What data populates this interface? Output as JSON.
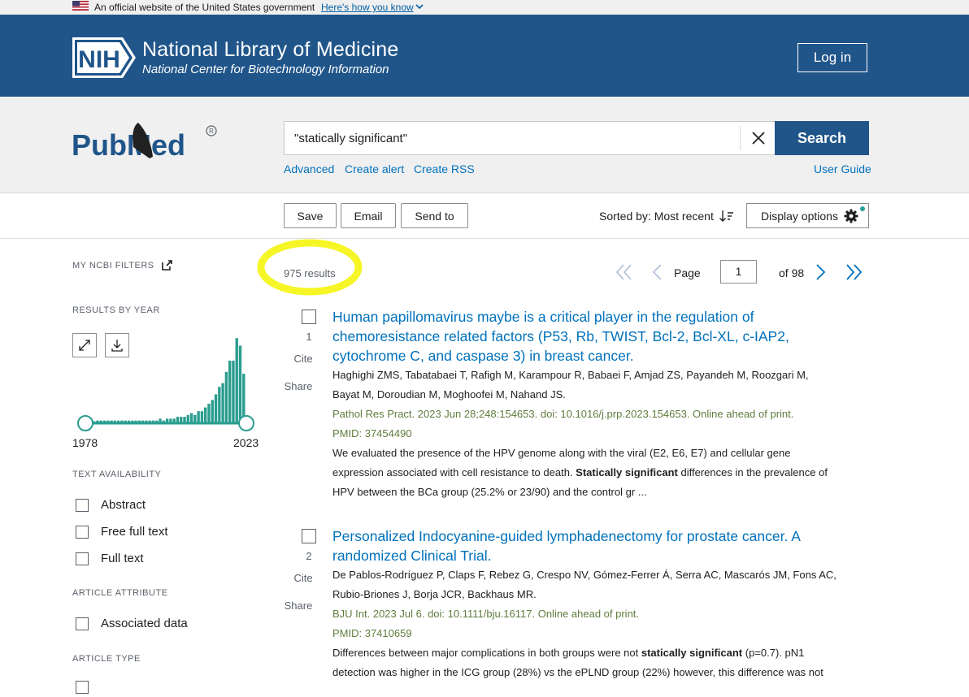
{
  "gov_banner": {
    "text": "An official website of the United States government",
    "link": "Here's how you know"
  },
  "nih_header": {
    "logo_text": "NIH",
    "title": "National Library of Medicine",
    "subtitle": "National Center for Biotechnology Information",
    "login": "Log in"
  },
  "search": {
    "logo_text": "PubMed",
    "query": "\"statically significant\"",
    "button": "Search",
    "links": [
      "Advanced",
      "Create alert",
      "Create RSS"
    ],
    "user_guide": "User Guide"
  },
  "toolbar": {
    "save": "Save",
    "email": "Email",
    "send_to": "Send to",
    "sort": "Sorted by: Most recent",
    "display_options": "Display options"
  },
  "sidebar": {
    "my_filters": "MY NCBI FILTERS",
    "results_by_year": "RESULTS BY YEAR",
    "year_start": "1978",
    "year_end": "2023",
    "text_availability": "TEXT AVAILABILITY",
    "text_filters": [
      "Abstract",
      "Free full text",
      "Full text"
    ],
    "article_attribute": "ARTICLE ATTRIBUTE",
    "attribute_filters": [
      "Associated data"
    ],
    "article_type": "ARTICLE TYPE"
  },
  "chart_data": {
    "type": "bar",
    "x": [
      1978,
      1979,
      1980,
      1981,
      1982,
      1983,
      1984,
      1985,
      1986,
      1987,
      1988,
      1989,
      1990,
      1991,
      1992,
      1993,
      1994,
      1995,
      1996,
      1997,
      1998,
      1999,
      2000,
      2001,
      2002,
      2003,
      2004,
      2005,
      2006,
      2007,
      2008,
      2009,
      2010,
      2011,
      2012,
      2013,
      2014,
      2015,
      2016,
      2017,
      2018,
      2019,
      2020,
      2021,
      2022,
      2023
    ],
    "values": [
      1,
      0,
      0,
      1,
      1,
      1,
      1,
      1,
      1,
      1,
      1,
      1,
      1,
      1,
      1,
      1,
      1,
      1,
      1,
      1,
      1,
      2,
      1,
      2,
      2,
      2,
      3,
      3,
      3,
      4,
      5,
      4,
      6,
      6,
      8,
      10,
      12,
      15,
      19,
      21,
      27,
      33,
      33,
      45,
      41,
      26
    ],
    "xlabel": "",
    "ylabel": "",
    "ylim": [
      0,
      46
    ]
  },
  "results": {
    "count": "975 results",
    "page_label": "Page",
    "page": "1",
    "of_pages": "of 98",
    "articles": [
      {
        "number": "1",
        "cite": "Cite",
        "share": "Share",
        "title": "Human papillomavirus maybe is a critical player in the regulation of chemoresistance related factors (P53, Rb, TWIST, Bcl-2, Bcl-XL, c-IAP2, cytochrome C, and caspase 3) in breast cancer.",
        "authors_1": "Haghighi ZMS, Tabatabaei T, Rafigh M, Karampour R, Babaei F, Amjad ZS, Payandeh M, Roozgari M,",
        "authors_2": "Bayat M, Doroudian M, Moghoofei M, Nahand JS.",
        "journal": "Pathol Res Pract. 2023 Jun 28;248:154653. doi: 10.1016/j.prp.2023.154653. Online ahead of print.",
        "pmid": "PMID: 37454490",
        "snippet_1": "We evaluated the presence of the HPV genome along with the viral (E2, E6, E7) and cellular gene",
        "snippet_2a": "expression associated with cell resistance to death.",
        "snippet_2hl": "Statically significant",
        "snippet_2b": "differences in the prevalence of",
        "snippet_3": "HPV between the BCa group (25.2% or 23/90) and the control gr ..."
      },
      {
        "number": "2",
        "cite": "Cite",
        "share": "Share",
        "title": "Personalized Indocyanine-guided lymphadenectomy for prostate cancer. A randomized Clinical Trial.",
        "authors_1": "De Pablos-Rodríguez P, Claps F, Rebez G, Crespo NV, Gómez-Ferrer Á, Serra AC, Mascarós JM, Fons AC,",
        "authors_2": "Rubio-Briones J, Borja JCR, Backhaus MR.",
        "journal": "BJU Int. 2023 Jul 6. doi: 10.1111/bju.16117. Online ahead of print.",
        "pmid": "PMID: 37410659",
        "snippet_1a": "Differences between major complications in both groups were not",
        "snippet_1hl": "statically significant",
        "snippet_1b": "(p=0.7). pN1",
        "snippet_2": "detection was higher in the ICG group (28%) vs the ePLND group (22%) however, this difference was not"
      }
    ]
  },
  "colors": {
    "nih_blue": "#20558a",
    "link_blue": "#0071bc",
    "journal_green": "#5f7c3d",
    "histogram_teal": "#2a9d8f",
    "highlight_yellow": "#f5f500"
  }
}
